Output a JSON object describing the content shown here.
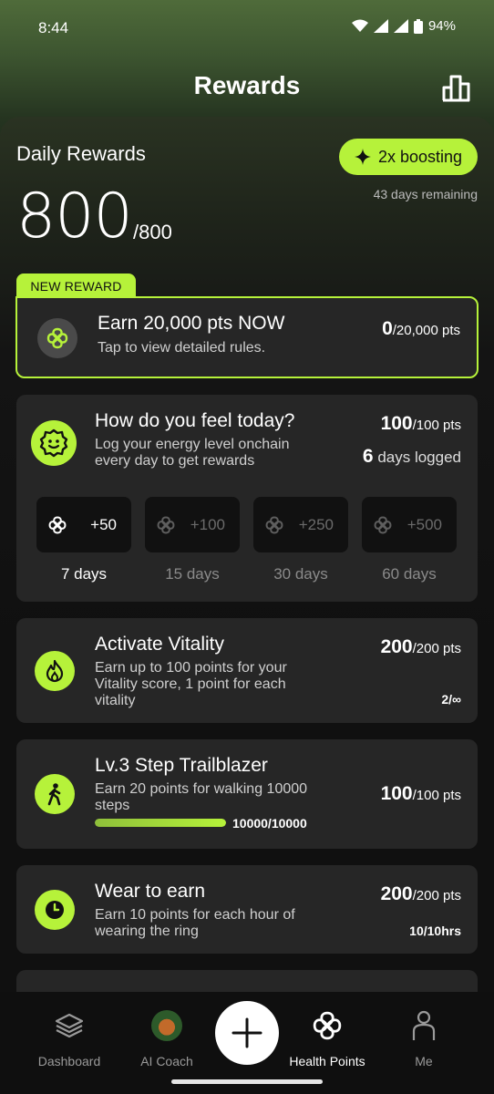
{
  "status_bar": {
    "time": "8:44",
    "battery": "94%"
  },
  "header": {
    "title": "Rewards",
    "stats_icon": "bar-chart-icon"
  },
  "daily": {
    "title": "Daily Rewards",
    "score": "800",
    "max": "/800",
    "boost_label": "2x boosting",
    "days_remaining": "43 days remaining"
  },
  "new_reward": {
    "tag": "NEW REWARD",
    "title": "Earn 20,000 pts NOW",
    "subtitle": "Tap to view detailed rules.",
    "points_current": "0",
    "points_total": "/20,000 pts"
  },
  "feel": {
    "title": "How do you feel today?",
    "desc_line1": "Log your energy level onchain",
    "desc_line2": "every day to get rewards",
    "points_current": "100",
    "points_total": "/100 pts",
    "days_logged_count": "6",
    "days_logged_label": " days logged",
    "tiles": [
      {
        "bonus": "+50",
        "label": "7 days"
      },
      {
        "bonus": "+100",
        "label": "15 days"
      },
      {
        "bonus": "+250",
        "label": "30 days"
      },
      {
        "bonus": "+500",
        "label": "60 days"
      }
    ]
  },
  "vitality": {
    "title": "Activate Vitality",
    "desc_line1": "Earn up to 100 points for your",
    "desc_line2": "Vitality score, 1 point for each",
    "desc_line3": "vitality",
    "points_current": "200",
    "points_total": "/200 pts",
    "meta": "2/∞"
  },
  "steps": {
    "title": "Lv.3 Step Trailblazer",
    "desc_line1": "Earn 20 points for walking 10000",
    "desc_line2": "steps",
    "progress_fraction": 1.0,
    "progress_text": "10000/10000",
    "points_current": "100",
    "points_total": "/100 pts"
  },
  "wear": {
    "title": "Wear to earn",
    "desc_line1": "Earn 10 points for each hour of",
    "desc_line2": "wearing the ring",
    "points_current": "200",
    "points_total": "/200 pts",
    "meta": "10/10hrs"
  },
  "nav": {
    "items": [
      {
        "label": "Dashboard"
      },
      {
        "label": "AI Coach"
      },
      {
        "label": "Health Points"
      },
      {
        "label": "Me"
      }
    ]
  },
  "colors": {
    "accent": "#b6f23a",
    "card": "#262626",
    "background": "#111111"
  }
}
